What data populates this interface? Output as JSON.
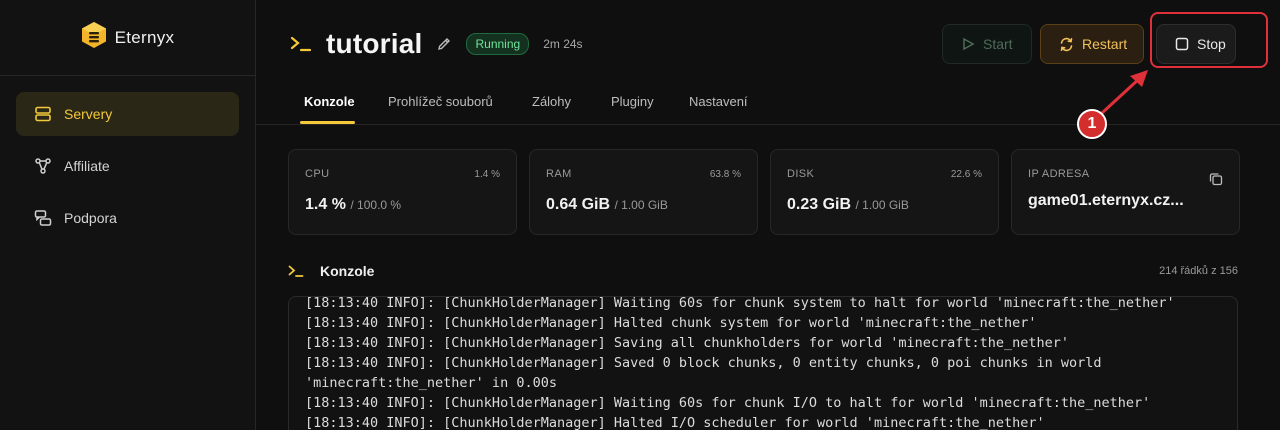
{
  "brand": {
    "name": "Eternyx",
    "accent": "#f3c93a"
  },
  "sidebar": {
    "items": [
      {
        "label": "Servery",
        "icon": "server-icon",
        "active": true
      },
      {
        "label": "Affiliate",
        "icon": "affiliate-icon",
        "active": false
      },
      {
        "label": "Podpora",
        "icon": "chat-icon",
        "active": false
      }
    ]
  },
  "header": {
    "title": "tutorial",
    "status": "Running",
    "uptime": "2m 24s",
    "buttons": {
      "start": "Start",
      "restart": "Restart",
      "stop": "Stop"
    }
  },
  "tabs": [
    {
      "label": "Konzole",
      "active": true
    },
    {
      "label": "Prohlížeč souborů",
      "active": false
    },
    {
      "label": "Zálohy",
      "active": false
    },
    {
      "label": "Pluginy",
      "active": false
    },
    {
      "label": "Nastavení",
      "active": false
    }
  ],
  "stats": {
    "cpu": {
      "label": "CPU",
      "percent": "1.4 %",
      "value": "1.4 %",
      "total": "/ 100.0 %"
    },
    "ram": {
      "label": "RAM",
      "percent": "63.8 %",
      "value": "0.64 GiB",
      "total": "/ 1.00 GiB"
    },
    "disk": {
      "label": "DISK",
      "percent": "22.6 %",
      "value": "0.23 GiB",
      "total": "/ 1.00 GiB"
    },
    "ip": {
      "label": "IP ADRESA",
      "value": "game01.eternyx.cz..."
    }
  },
  "console": {
    "title": "Konzole",
    "count": "214 řádků z 156",
    "lines": [
      "[18:13:40 INFO]: [ChunkHolderManager] Waiting 60s for chunk system to halt for world 'minecraft:the_nether'",
      "[18:13:40 INFO]: [ChunkHolderManager] Halted chunk system for world 'minecraft:the_nether'",
      "[18:13:40 INFO]: [ChunkHolderManager] Saving all chunkholders for world 'minecraft:the_nether'",
      "[18:13:40 INFO]: [ChunkHolderManager] Saved 0 block chunks, 0 entity chunks, 0 poi chunks in world 'minecraft:the_nether' in 0.00s",
      "[18:13:40 INFO]: [ChunkHolderManager] Waiting 60s for chunk I/O to halt for world 'minecraft:the_nether'",
      "[18:13:40 INFO]: [ChunkHolderManager] Halted I/O scheduler for world 'minecraft:the_nether'"
    ]
  },
  "annotation": {
    "marker": "1",
    "color": "#e0303a"
  }
}
